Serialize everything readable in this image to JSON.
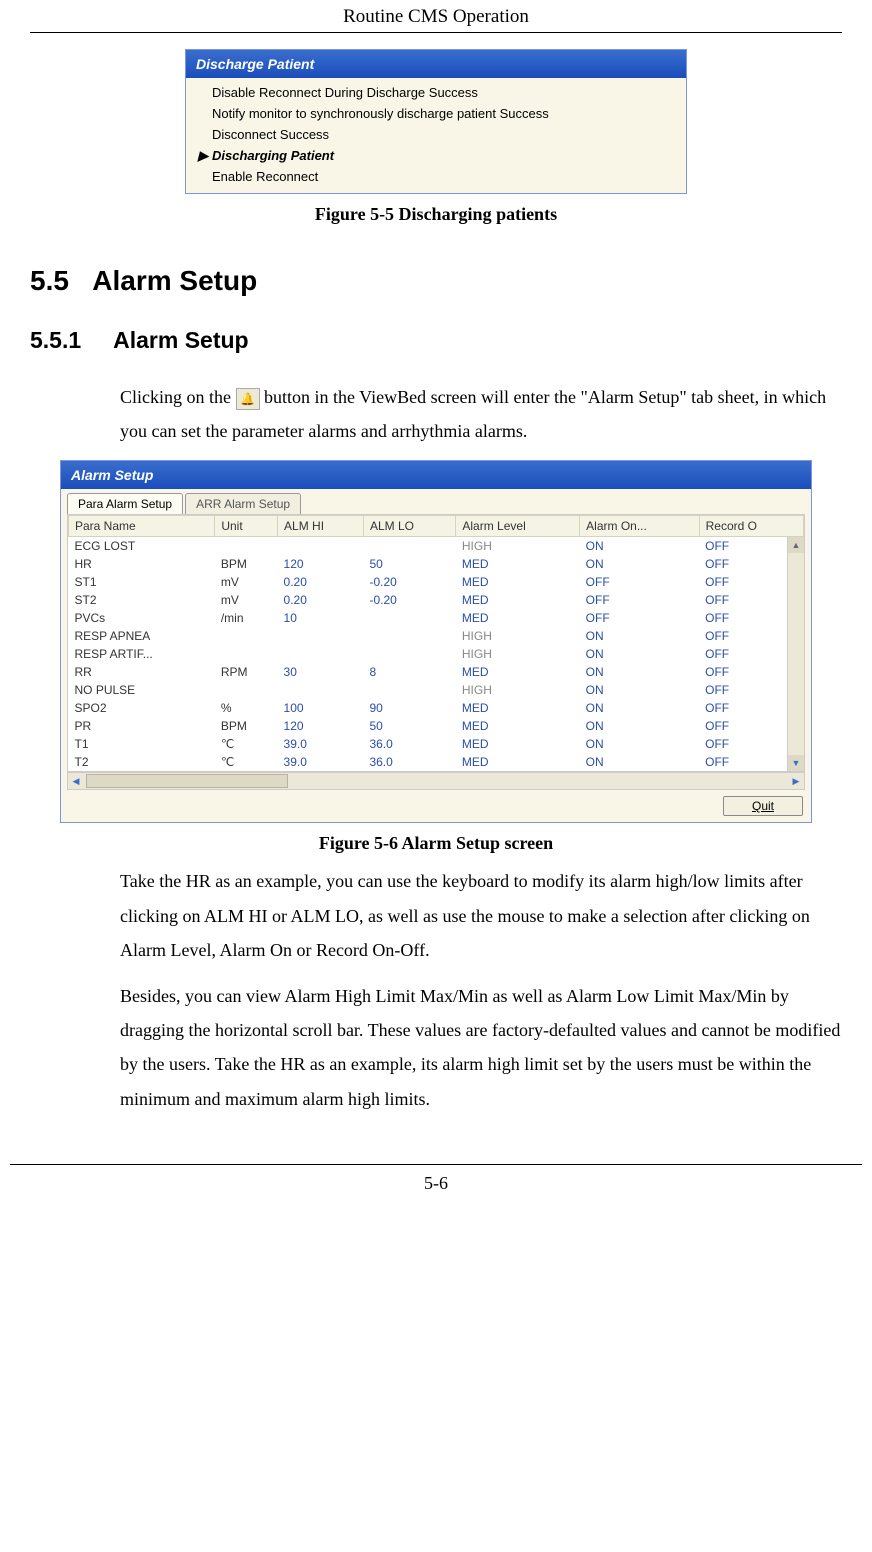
{
  "header": {
    "title": "Routine CMS Operation"
  },
  "discharge_dialog": {
    "title": "Discharge Patient",
    "rows": [
      {
        "text": "Disable Reconnect During Discharge    Success",
        "bold": false,
        "marker": ""
      },
      {
        "text": "Notify monitor to synchronously discharge patient    Success",
        "bold": false,
        "marker": ""
      },
      {
        "text": "Disconnect    Success",
        "bold": false,
        "marker": ""
      },
      {
        "text": "Discharging Patient",
        "bold": true,
        "marker": "▶"
      },
      {
        "text": "Enable Reconnect",
        "bold": false,
        "marker": ""
      }
    ]
  },
  "caption1": "Figure 5-5 Discharging patients",
  "section": {
    "num": "5.5",
    "title": "Alarm Setup"
  },
  "subsection": {
    "num": "5.5.1",
    "title": "Alarm Setup"
  },
  "para1a": "Clicking on the ",
  "para1b": " button in the ViewBed screen will enter the \"Alarm Setup\" tab sheet, in which you can set the parameter alarms and arrhythmia alarms.",
  "alarm_dialog": {
    "title": "Alarm Setup",
    "tabs": [
      {
        "label": "Para Alarm Setup",
        "active": true
      },
      {
        "label": "ARR Alarm Setup",
        "active": false
      }
    ],
    "columns": [
      "Para Name",
      "Unit",
      "ALM HI",
      "ALM LO",
      "Alarm Level",
      "Alarm On...",
      "Record O"
    ],
    "rows": [
      {
        "name": "ECG LOST",
        "unit": "",
        "hi": "",
        "lo": "",
        "level": "HIGH",
        "level_gray": true,
        "on": "ON",
        "rec": "OFF"
      },
      {
        "name": "HR",
        "unit": "BPM",
        "hi": "120",
        "lo": "50",
        "level": "MED",
        "on": "ON",
        "rec": "OFF"
      },
      {
        "name": "ST1",
        "unit": "mV",
        "hi": "0.20",
        "lo": "-0.20",
        "level": "MED",
        "on": "OFF",
        "rec": "OFF"
      },
      {
        "name": "ST2",
        "unit": "mV",
        "hi": "0.20",
        "lo": "-0.20",
        "level": "MED",
        "on": "OFF",
        "rec": "OFF"
      },
      {
        "name": "PVCs",
        "unit": "/min",
        "hi": "10",
        "lo": "",
        "level": "MED",
        "on": "OFF",
        "rec": "OFF"
      },
      {
        "name": "RESP APNEA",
        "unit": "",
        "hi": "",
        "lo": "",
        "level": "HIGH",
        "level_gray": true,
        "on": "ON",
        "rec": "OFF"
      },
      {
        "name": "RESP ARTIF...",
        "unit": "",
        "hi": "",
        "lo": "",
        "level": "HIGH",
        "level_gray": true,
        "on": "ON",
        "rec": "OFF"
      },
      {
        "name": "RR",
        "unit": "RPM",
        "hi": "30",
        "lo": "8",
        "level": "MED",
        "on": "ON",
        "rec": "OFF"
      },
      {
        "name": "NO PULSE",
        "unit": "",
        "hi": "",
        "lo": "",
        "level": "HIGH",
        "level_gray": true,
        "on": "ON",
        "rec": "OFF"
      },
      {
        "name": "SPO2",
        "unit": "%",
        "hi": "100",
        "lo": "90",
        "level": "MED",
        "on": "ON",
        "rec": "OFF"
      },
      {
        "name": "PR",
        "unit": "BPM",
        "hi": "120",
        "lo": "50",
        "level": "MED",
        "on": "ON",
        "rec": "OFF"
      },
      {
        "name": "T1",
        "unit": "℃",
        "hi": "39.0",
        "lo": "36.0",
        "level": "MED",
        "on": "ON",
        "rec": "OFF"
      },
      {
        "name": "T2",
        "unit": "℃",
        "hi": "39.0",
        "lo": "36.0",
        "level": "MED",
        "on": "ON",
        "rec": "OFF"
      }
    ],
    "quit_label": "Quit"
  },
  "caption2": "Figure 5-6 Alarm Setup screen",
  "para2": "Take the HR as an example, you can use the keyboard to modify its alarm high/low limits after clicking on ALM HI or ALM LO, as well as use the mouse to make a selection after clicking on Alarm Level, Alarm On or Record On-Off.",
  "para3": "Besides, you can view Alarm High Limit Max/Min as well as Alarm Low Limit Max/Min by dragging the horizontal scroll bar. These values are factory-defaulted values and cannot be modified by the users. Take the HR as an example, its alarm high limit set by the users must be within the minimum and maximum alarm high limits.",
  "page_number": "5-6"
}
